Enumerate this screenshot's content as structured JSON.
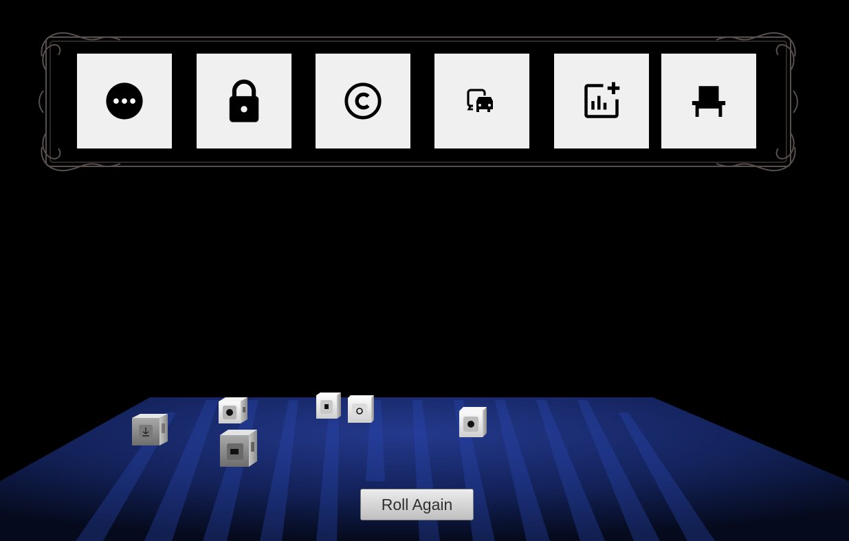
{
  "toolbar": {
    "slots": [
      {
        "icon": "more-horizontal-icon"
      },
      {
        "icon": "lock-icon"
      },
      {
        "icon": "copyright-icon"
      },
      {
        "icon": "commute-icon"
      },
      {
        "icon": "add-chart-icon"
      },
      {
        "icon": "chair-icon"
      }
    ]
  },
  "board": {
    "felt_color": "#1c2f7a",
    "stripe_color": "#2b4dbd"
  },
  "dice": [
    {
      "face": "download-icon"
    },
    {
      "face": "more-horizontal-icon"
    },
    {
      "face": "commute-icon"
    },
    {
      "face": "lock-icon"
    },
    {
      "face": "copyright-icon"
    },
    {
      "face": "more-horizontal-icon"
    }
  ],
  "actions": {
    "roll_label": "Roll Again"
  }
}
